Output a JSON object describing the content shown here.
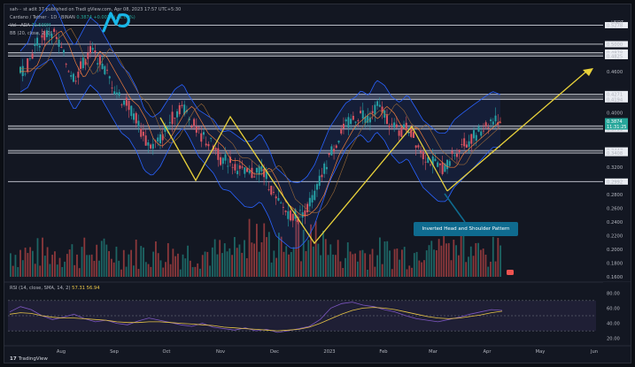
{
  "header": {
    "publisher_line": "sah··· st adit 37 published on Tradi gView.com, Apr 08, 2023 17:57 UTC+5:30",
    "symbol_line": "Cardano / Tether · 1D · BINAN",
    "price_change": "0.3874  +0.0019 (+1.02%)",
    "vol_label": "Vol · ADA",
    "vol_value": "71.599M",
    "bb_label": "BB (20, close, 2, 0)"
  },
  "currency": "USDT",
  "price_axis": {
    "ticks": [
      "0.5278",
      "0.5000",
      "0.4878",
      "0.4825",
      "0.4600",
      "0.4271",
      "0.4194",
      "0.4000",
      "0.3874",
      "0.3807",
      "0.3759",
      "0.3447",
      "0.3408",
      "0.3200",
      "0.2992",
      "0.2800",
      "0.2600",
      "0.2400",
      "0.2200",
      "0.2000",
      "0.1800",
      "0.1600"
    ],
    "current_price": "0.3874",
    "countdown": "11:31:25"
  },
  "time_axis": [
    "Aug",
    "Sep",
    "Oct",
    "Nov",
    "Dec",
    "2023",
    "Feb",
    "Mar",
    "Apr",
    "May",
    "Jun"
  ],
  "annotation": "Inverted Head and Shoulder Pattern",
  "rsi": {
    "title": "RSI (14, close, SMA, 14, 2)",
    "value1": "57.31",
    "value2": "56.94",
    "ticks": [
      "80.00",
      "60.00",
      "40.00",
      "20.00"
    ]
  },
  "brand": "TradingView",
  "colors": {
    "background": "#131722",
    "up": "#26a69a",
    "down": "#ef5350",
    "pattern": "#e8d13b",
    "bb": "#2962ff",
    "annotation_bg": "#0f6b8f"
  },
  "chart_data": {
    "type": "candlestick",
    "title": "Cardano / Tether · 1D · BINANCE",
    "ylim": [
      0.16,
      0.54
    ],
    "x_categories": [
      "Aug",
      "Sep",
      "Oct",
      "Nov",
      "Dec",
      "2023",
      "Feb",
      "Mar",
      "Apr",
      "May",
      "Jun"
    ],
    "price_path": [
      0.46,
      0.47,
      0.5,
      0.51,
      0.52,
      0.5,
      0.47,
      0.45,
      0.47,
      0.49,
      0.48,
      0.46,
      0.44,
      0.42,
      0.41,
      0.39,
      0.36,
      0.35,
      0.36,
      0.38,
      0.4,
      0.41,
      0.39,
      0.37,
      0.36,
      0.35,
      0.33,
      0.33,
      0.32,
      0.31,
      0.31,
      0.32,
      0.3,
      0.27,
      0.26,
      0.25,
      0.25,
      0.26,
      0.28,
      0.31,
      0.34,
      0.36,
      0.38,
      0.39,
      0.4,
      0.39,
      0.41,
      0.4,
      0.38,
      0.37,
      0.38,
      0.36,
      0.34,
      0.33,
      0.32,
      0.32,
      0.34,
      0.35,
      0.36,
      0.37,
      0.38,
      0.39,
      0.388
    ],
    "horizontal_levels": [
      0.5278,
      0.5,
      0.4878,
      0.4825,
      0.4271,
      0.4194,
      0.3807,
      0.3759,
      0.3447,
      0.3408,
      0.2992
    ],
    "pattern_points": [
      [
        0.405,
        "left-shoulder-start"
      ],
      [
        0.31,
        "left-shoulder-low"
      ],
      [
        0.375,
        "neck-1"
      ],
      [
        0.215,
        "head-low"
      ],
      [
        0.395,
        "neck-2"
      ],
      [
        0.298,
        "right-shoulder-low"
      ],
      [
        0.476,
        "target"
      ]
    ],
    "rsi_path": [
      55,
      62,
      58,
      50,
      45,
      48,
      52,
      46,
      42,
      44,
      40,
      38,
      43,
      47,
      44,
      41,
      38,
      36,
      40,
      35,
      33,
      31,
      34,
      30,
      32,
      28,
      30,
      33,
      36,
      45,
      60,
      66,
      68,
      64,
      62,
      58,
      55,
      50,
      46,
      44,
      42,
      45,
      48,
      52,
      55,
      58,
      57
    ],
    "rsi_sma_path": [
      52,
      54,
      53,
      50,
      48,
      47,
      47,
      46,
      45,
      44,
      42,
      41,
      41,
      42,
      42,
      41,
      40,
      39,
      38,
      37,
      35,
      34,
      33,
      32,
      31,
      30,
      31,
      32,
      35,
      40,
      46,
      52,
      57,
      60,
      61,
      60,
      58,
      55,
      52,
      49,
      47,
      46,
      47,
      49,
      51,
      54,
      56
    ]
  }
}
